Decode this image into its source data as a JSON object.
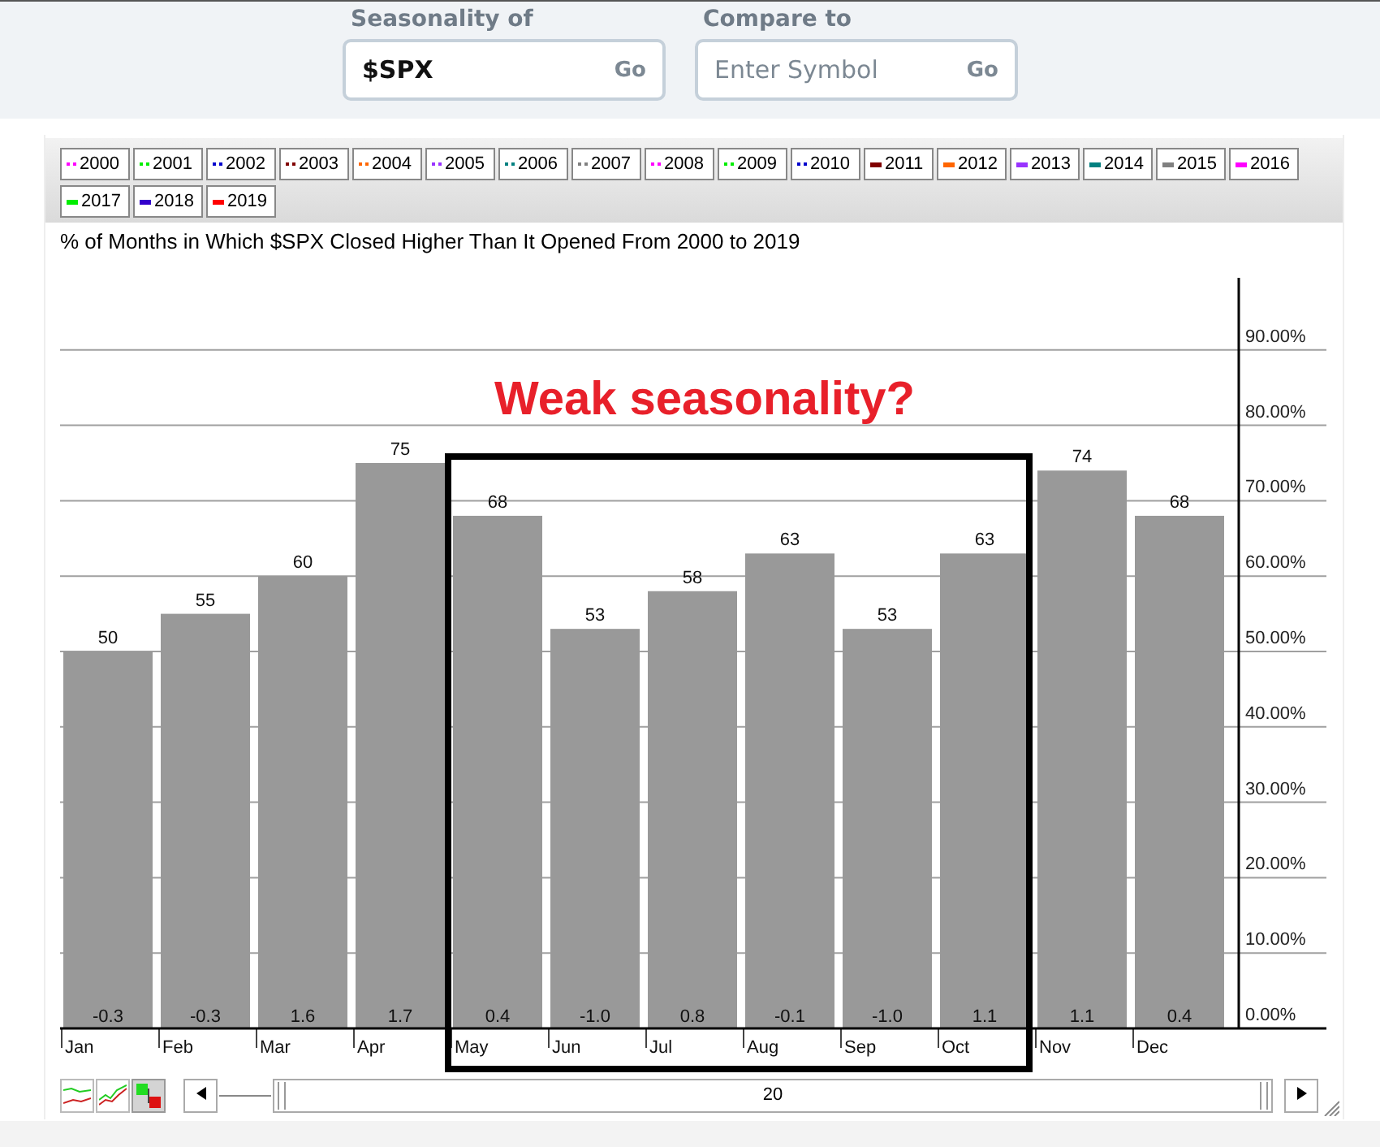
{
  "search_bar": {
    "fields": [
      {
        "label": "Seasonality of",
        "value": "$SPX",
        "button": "Go"
      },
      {
        "label": "Compare to",
        "placeholder": "Enter Symbol",
        "button": "Go"
      }
    ]
  },
  "legend": [
    {
      "label": "2000",
      "kind": "dotted",
      "color": "#ff00ff"
    },
    {
      "label": "2001",
      "kind": "dotted",
      "color": "#00ee00"
    },
    {
      "label": "2002",
      "kind": "dotted",
      "color": "#0000cc"
    },
    {
      "label": "2003",
      "kind": "dotted",
      "color": "#800000"
    },
    {
      "label": "2004",
      "kind": "dotted",
      "color": "#ff6600"
    },
    {
      "label": "2005",
      "kind": "dotted",
      "color": "#9933ff"
    },
    {
      "label": "2006",
      "kind": "dotted",
      "color": "#008080"
    },
    {
      "label": "2007",
      "kind": "dotted",
      "color": "#808080"
    },
    {
      "label": "2008",
      "kind": "dotted",
      "color": "#ff00ff"
    },
    {
      "label": "2009",
      "kind": "dotted",
      "color": "#00ee00"
    },
    {
      "label": "2010",
      "kind": "dotted",
      "color": "#0000cc"
    },
    {
      "label": "2011",
      "kind": "solid",
      "color": "#800000"
    },
    {
      "label": "2012",
      "kind": "solid",
      "color": "#ff6600"
    },
    {
      "label": "2013",
      "kind": "solid",
      "color": "#9933ff"
    },
    {
      "label": "2014",
      "kind": "solid",
      "color": "#008080"
    },
    {
      "label": "2015",
      "kind": "solid",
      "color": "#808080"
    },
    {
      "label": "2016",
      "kind": "solid",
      "color": "#ff00ff"
    },
    {
      "label": "2017",
      "kind": "solid",
      "color": "#00ee00"
    },
    {
      "label": "2018",
      "kind": "solid",
      "color": "#3300cc"
    },
    {
      "label": "2019",
      "kind": "solid",
      "color": "#ff0000"
    }
  ],
  "chart": {
    "chart_data": {
      "type": "bar",
      "title": "% of Months in Which $SPX Closed Higher Than It Opened From 2000 to 2019",
      "categories": [
        "Jan",
        "Feb",
        "Mar",
        "Apr",
        "May",
        "Jun",
        "Jul",
        "Aug",
        "Sep",
        "Oct",
        "Nov",
        "Dec"
      ],
      "series": [
        {
          "color": "#999999",
          "values": [
            50,
            55,
            60,
            75,
            68,
            53,
            58,
            63,
            53,
            63,
            74,
            68
          ]
        }
      ],
      "ylim": [
        0,
        100
      ],
      "yticks": [
        {
          "value": 0,
          "label": "0.00%"
        },
        {
          "value": 10,
          "label": "10.00%"
        },
        {
          "value": 20,
          "label": "20.00%"
        },
        {
          "value": 30,
          "label": "30.00%"
        },
        {
          "value": 40,
          "label": "40.00%"
        },
        {
          "value": 50,
          "label": "50.00%"
        },
        {
          "value": 60,
          "label": "60.00%"
        },
        {
          "value": 70,
          "label": "70.00%"
        },
        {
          "value": 80,
          "label": "80.00%"
        },
        {
          "value": 90,
          "label": "90.00%"
        }
      ],
      "grid": true,
      "data_labels": true
    },
    "bar_bottom_labels": [
      "-0.3",
      "-0.3",
      "1.6",
      "1.7",
      "0.4",
      "-1.0",
      "0.8",
      "-0.1",
      "-1.0",
      "1.1",
      "1.1",
      "0.4"
    ],
    "annotation": {
      "text": "Weak seasonality?"
    }
  },
  "chart_type_buttons": [
    {
      "kind": "line",
      "selected": false
    },
    {
      "kind": "performance",
      "selected": false
    },
    {
      "kind": "bar",
      "selected": true
    }
  ],
  "range_scroller": {
    "label": "20"
  }
}
